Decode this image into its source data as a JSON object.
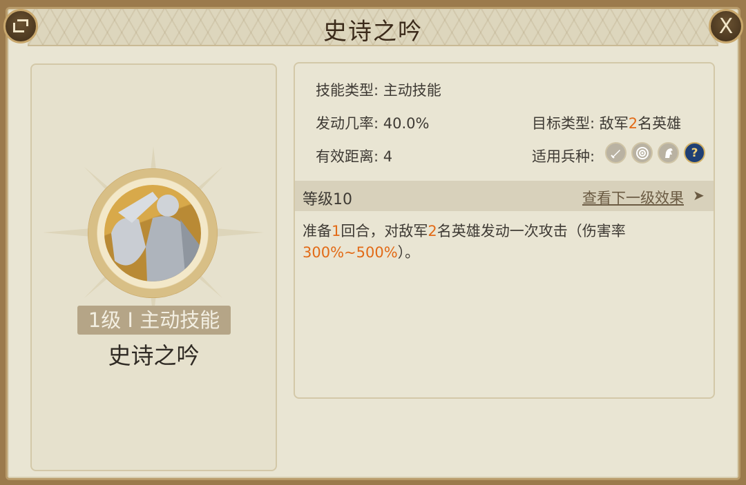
{
  "header": {
    "title": "史诗之吟"
  },
  "icons": {
    "share": "share-icon",
    "close": "close-icon",
    "troops": [
      "sword-icon",
      "target-icon",
      "horse-icon",
      "question-icon"
    ]
  },
  "close_label": "X",
  "skill_card": {
    "level_type": "1级 I 主动技能",
    "name": "史诗之吟"
  },
  "details": {
    "skill_type_label": "技能类型:",
    "skill_type_value": "主动技能",
    "trigger_rate_label": "发动几率:",
    "trigger_rate_value": "40.0%",
    "range_label": "有效距离:",
    "range_value": "4",
    "target_label": "目标类型:",
    "target_prefix": "敌军",
    "target_count": "2",
    "target_suffix": "名英雄",
    "troop_label": "适用兵种:",
    "troop_help_glyph": "?"
  },
  "level_section": {
    "label": "等级10",
    "next_link": "查看下一级效果",
    "next_arrow": "➤"
  },
  "description": {
    "p1": "准备",
    "n1": "1",
    "p2": "回合，对敌军",
    "n2": "2",
    "p3": "名英雄发动一次攻击（伤害率",
    "range": "300%~500%",
    "p4": "）。"
  },
  "colors": {
    "highlight": "#e26a16",
    "panel_bg": "#e9e5d3",
    "frame": "#b99c6b"
  }
}
